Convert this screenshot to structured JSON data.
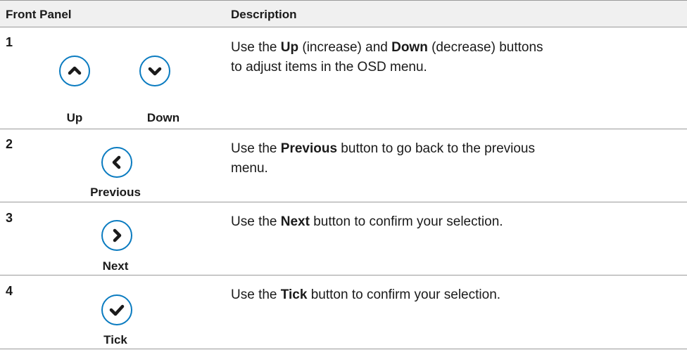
{
  "header": {
    "col1": "Front Panel",
    "col2": "Description"
  },
  "rows": [
    {
      "num": "1",
      "buttons": [
        {
          "label": "Up",
          "icon": "chevron-up-icon"
        },
        {
          "label": "Down",
          "icon": "chevron-down-icon"
        }
      ],
      "desc": {
        "p1": "Use the ",
        "b1": "Up",
        "p2": " (increase) and ",
        "b2": "Down",
        "p3": " (decrease) buttons to adjust items in the OSD menu."
      }
    },
    {
      "num": "2",
      "buttons": [
        {
          "label": "Previous",
          "icon": "chevron-left-icon"
        }
      ],
      "desc": {
        "p1": "Use the ",
        "b1": "Previous",
        "p2": " button to go back to the previous menu."
      }
    },
    {
      "num": "3",
      "buttons": [
        {
          "label": "Next",
          "icon": "chevron-right-icon"
        }
      ],
      "desc": {
        "p1": "Use the ",
        "b1": "Next",
        "p2": " button to confirm your selection."
      }
    },
    {
      "num": "4",
      "buttons": [
        {
          "label": "Tick",
          "icon": "checkmark-icon"
        }
      ],
      "desc": {
        "p1": "Use the ",
        "b1": "Tick",
        "p2": " button to confirm your selection."
      }
    }
  ],
  "colors": {
    "icon_stroke": "#0a7bc0",
    "rule": "#9a9a9a",
    "header_bg": "#f0f0f0"
  }
}
